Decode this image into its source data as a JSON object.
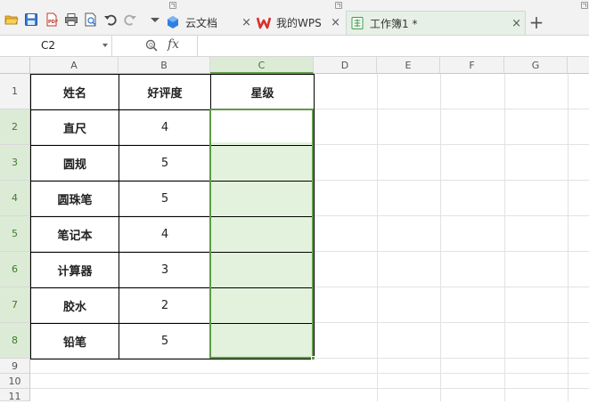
{
  "toolbar": {
    "icons": [
      "open-folder-icon",
      "save-icon",
      "pdf-export-icon",
      "print-icon",
      "print-preview-icon",
      "undo-icon",
      "redo-icon",
      "dropdown-icon"
    ]
  },
  "tabs": [
    {
      "label": "云文档",
      "icon": "cloud-docs-icon"
    },
    {
      "label": "我的WPS",
      "icon": "wps-logo-icon"
    },
    {
      "label": "工作簿1 *",
      "icon": "workbook-icon",
      "active": true
    }
  ],
  "new_tab_label": "+",
  "close_glyph": "×",
  "formula_bar": {
    "name_box": "C2",
    "fx_label": "fx",
    "formula_value": ""
  },
  "columns": [
    "A",
    "B",
    "C",
    "D",
    "E",
    "F",
    "G"
  ],
  "rows": [
    "1",
    "2",
    "3",
    "4",
    "5",
    "6",
    "7",
    "8",
    "9",
    "10",
    "11"
  ],
  "table": {
    "headers": [
      "姓名",
      "好评度",
      "星级"
    ],
    "data": [
      {
        "name": "直尺",
        "rating": "4",
        "stars": ""
      },
      {
        "name": "圆规",
        "rating": "5",
        "stars": ""
      },
      {
        "name": "圆珠笔",
        "rating": "5",
        "stars": ""
      },
      {
        "name": "笔记本",
        "rating": "4",
        "stars": ""
      },
      {
        "name": "计算器",
        "rating": "3",
        "stars": ""
      },
      {
        "name": "胶水",
        "rating": "2",
        "stars": ""
      },
      {
        "name": "铅笔",
        "rating": "5",
        "stars": ""
      }
    ]
  },
  "selection": {
    "range": "C2:C8",
    "active": "C2",
    "color": "#5f9a45",
    "fill": "#e2f2dc"
  }
}
